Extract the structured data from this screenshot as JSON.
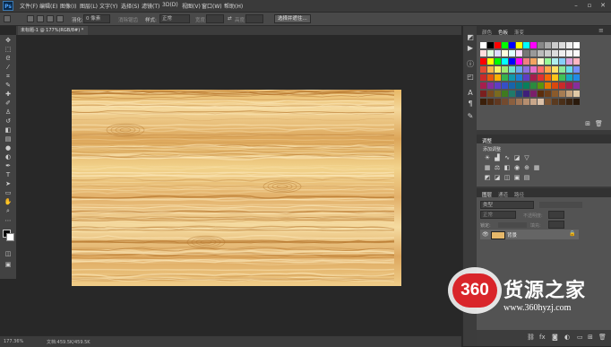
{
  "menubar": {
    "logo": "Ps",
    "items": [
      "文件(F)",
      "编辑(E)",
      "图像(I)",
      "图层(L)",
      "文字(Y)",
      "选择(S)",
      "滤镜(T)",
      "3D(D)",
      "视图(V)",
      "窗口(W)",
      "帮助(H)"
    ]
  },
  "options": {
    "feather_label": "羽化:",
    "feather_value": "0 像素",
    "antialias_label": "消除锯齿",
    "style_label": "样式:",
    "style_value": "正常",
    "width_label": "宽度:",
    "height_label": "高度:",
    "refine_button": "选择并遮住..."
  },
  "document": {
    "tab_title": "未标题-1 @ 177%(RGB/8#) *"
  },
  "status": {
    "zoom": "177.36%",
    "doc_info": "文档:459.5K/459.5K"
  },
  "panels": {
    "color_tabs": [
      "颜色",
      "色板",
      "渐变"
    ],
    "active_color_tab": "色板",
    "adjust_title": "调整",
    "adjust_subtitle": "添加调整",
    "layer_tabs": [
      "图层",
      "通道",
      "路径"
    ],
    "layer_kind": "类型",
    "blend_mode": "正常",
    "opacity_label": "不透明度:",
    "lock_label": "锁定:",
    "fill_label": "填充:",
    "layer_name": "背景"
  },
  "watermark": {
    "badge": "360",
    "brand": "货源之家",
    "url": "www.360hyzj.com"
  },
  "colors": {
    "menubar_bg": "#3a3a3a",
    "canvas_bg": "#282828",
    "panel_bg": "#535353",
    "wood_light": "#f2d38c",
    "wood_dark": "#b8782f",
    "watermark_red": "#d9252a"
  }
}
